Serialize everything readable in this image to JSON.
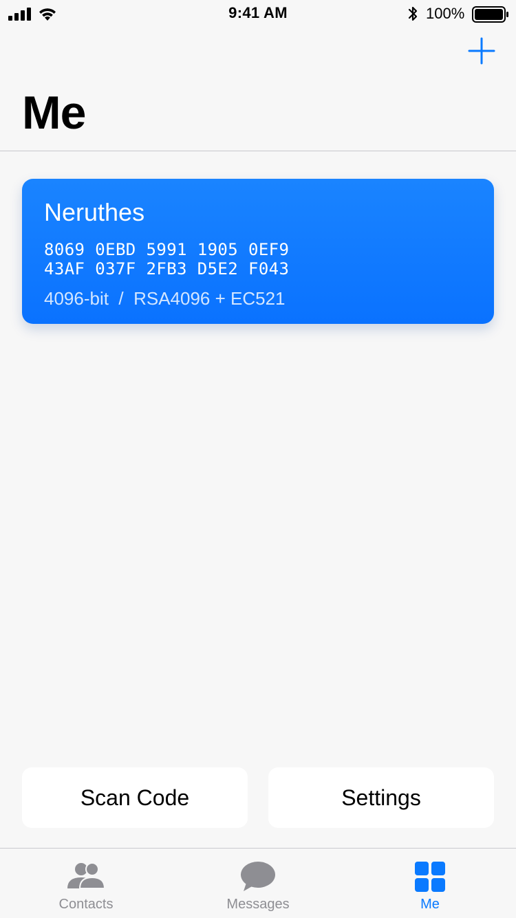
{
  "status_bar": {
    "time": "9:41 AM",
    "battery_percent": "100%",
    "signal_icon": "cellular-signal-icon",
    "wifi_icon": "wifi-icon",
    "bluetooth_icon": "bluetooth-icon",
    "battery_icon": "battery-icon",
    "battery_level": 1.0
  },
  "nav": {
    "add_icon": "plus-icon",
    "title": "Me"
  },
  "key_card": {
    "name": "Neruthes",
    "fingerprint_line1": "8069 0EBD 5991 1905 0EF9",
    "fingerprint_line2": "43AF 037F 2FB3 D5E2 F043",
    "meta": "4096-bit  /  RSA4096 + EC521",
    "color": "#0a7aff"
  },
  "actions": {
    "scan_label": "Scan Code",
    "settings_label": "Settings"
  },
  "tab_bar": {
    "tabs": [
      {
        "label": "Contacts",
        "icon": "contacts-icon",
        "active": false
      },
      {
        "label": "Messages",
        "icon": "messages-icon",
        "active": false
      },
      {
        "label": "Me",
        "icon": "grid-icon",
        "active": true
      }
    ],
    "active_color": "#0a7aff",
    "inactive_color": "#8e8e93"
  }
}
